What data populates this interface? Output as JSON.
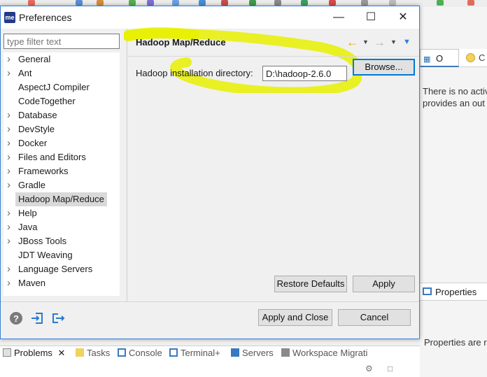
{
  "dialog": {
    "title": "Preferences",
    "app_icon": "me",
    "minimize_icon": "minimize-icon",
    "maximize_icon": "maximize-icon",
    "close_icon": "close-icon"
  },
  "filter": {
    "placeholder": "type filter text"
  },
  "tree": {
    "items": [
      {
        "label": "General",
        "expandable": true
      },
      {
        "label": "Ant",
        "expandable": true
      },
      {
        "label": "AspectJ Compiler",
        "expandable": false
      },
      {
        "label": "CodeTogether",
        "expandable": false
      },
      {
        "label": "Database",
        "expandable": true
      },
      {
        "label": "DevStyle",
        "expandable": true
      },
      {
        "label": "Docker",
        "expandable": true
      },
      {
        "label": "Files and Editors",
        "expandable": true
      },
      {
        "label": "Frameworks",
        "expandable": true
      },
      {
        "label": "Gradle",
        "expandable": true
      },
      {
        "label": "Hadoop Map/Reduce",
        "expandable": false,
        "selected": true
      },
      {
        "label": "Help",
        "expandable": true
      },
      {
        "label": "Java",
        "expandable": true
      },
      {
        "label": "JBoss Tools",
        "expandable": true
      },
      {
        "label": "JDT Weaving",
        "expandable": false
      },
      {
        "label": "Language Servers",
        "expandable": true
      },
      {
        "label": "Maven",
        "expandable": true
      }
    ]
  },
  "page": {
    "title": "Hadoop Map/Reduce",
    "field_label": "Hadoop installation directory:",
    "field_value": "D:\\hadoop-2.6.0",
    "browse_label": "Browse...",
    "restore_label": "Restore Defaults",
    "apply_label": "Apply",
    "highlight_color": "#e8f000"
  },
  "footer": {
    "apply_close_label": "Apply and Close",
    "cancel_label": "Cancel"
  },
  "background": {
    "right_tabs": [
      "O",
      "C"
    ],
    "right_message": [
      "There is no activ",
      "provides an out"
    ],
    "properties_tab": "Properties",
    "properties_message": "Properties are r",
    "bottom_tabs": [
      "Problems",
      "Tasks",
      "Console",
      "Terminal+",
      "Servers",
      "Workspace Migrati"
    ]
  }
}
